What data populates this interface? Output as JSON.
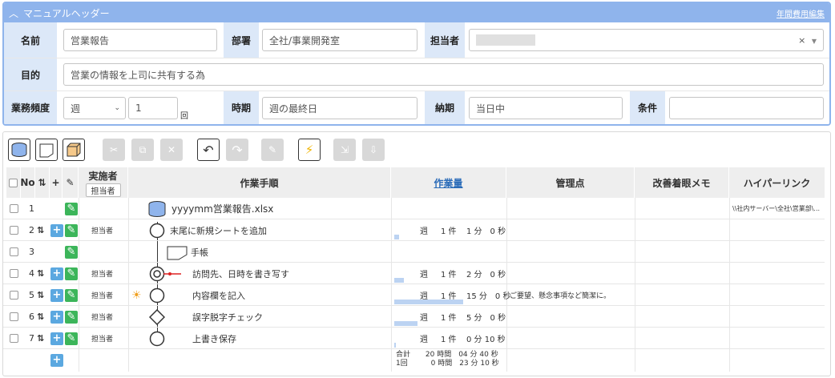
{
  "header": {
    "title": "マニュアルヘッダー",
    "link": "年間費用編集",
    "fields": {
      "name_label": "名前",
      "name_value": "営業報告",
      "dept_label": "部署",
      "dept_value": "全社/事業開発室",
      "owner_label": "担当者",
      "purpose_label": "目的",
      "purpose_value": "営業の情報を上司に共有する為",
      "freq_label": "業務頻度",
      "freq_select": "週",
      "freq_count": "1",
      "freq_unit": "回",
      "period_label": "時期",
      "period_value": "週の最終日",
      "deadline_label": "納期",
      "deadline_value": "当日中",
      "cond_label": "条件",
      "cond_value": ""
    },
    "clear_x": "×"
  },
  "table": {
    "headers": {
      "no": "No",
      "performer": "実施者",
      "performer_sub": "担当者",
      "procedure": "作業手順",
      "volume": "作業量",
      "control": "管理点",
      "memo": "改善着眼メモ",
      "link": "ハイパーリンク"
    },
    "rows": [
      {
        "no": "1",
        "performer": "",
        "step": "yyyymm営業報告.xlsx",
        "freq": "",
        "count": "",
        "time": "",
        "control": "",
        "link": "\\\\社内サーバー\\全社\\営業部\\...",
        "bar": 0
      },
      {
        "no": "2",
        "performer": "担当者",
        "step": "末尾に新規シートを追加",
        "freq": "週",
        "count": "1 件",
        "time": "1 分　0 秒",
        "control": "",
        "link": "",
        "bar": 0.04
      },
      {
        "no": "3",
        "performer": "",
        "step": "手帳",
        "freq": "",
        "count": "",
        "time": "",
        "control": "",
        "link": "",
        "bar": 0
      },
      {
        "no": "4",
        "performer": "担当者",
        "step": "訪問先、日時を書き写す",
        "freq": "週",
        "count": "1 件",
        "time": "2 分　0 秒",
        "control": "",
        "link": "",
        "bar": 0.09
      },
      {
        "no": "5",
        "performer": "担当者",
        "step": "内容欄を記入",
        "freq": "週",
        "count": "1 件",
        "time": "15 分　0 秒",
        "control": "ご要望、懸念事項など簡潔に。",
        "link": "",
        "bar": 0.62
      },
      {
        "no": "6",
        "performer": "担当者",
        "step": "誤字脱字チェック",
        "freq": "週",
        "count": "1 件",
        "time": "5 分　0 秒",
        "control": "",
        "link": "",
        "bar": 0.21
      },
      {
        "no": "7",
        "performer": "担当者",
        "step": "上書き保存",
        "freq": "週",
        "count": "1 件",
        "time": "0 分 10 秒",
        "control": "",
        "link": "",
        "bar": 0.01
      }
    ],
    "totals": {
      "total_label": "合計",
      "total_value": "20 時間　04 分 40 秒",
      "once_label": "1回",
      "once_value": "0 時間　23 分 10 秒"
    }
  },
  "colors": {
    "accent": "#8fb4ec",
    "label_bg": "#dce8f8",
    "plus": "#5ba8e0",
    "pen": "#3cb55a",
    "bar": "#bcd3f2"
  }
}
